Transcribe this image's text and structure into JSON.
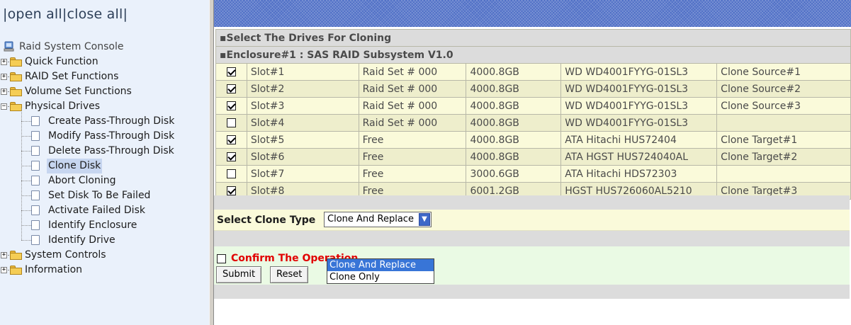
{
  "nav": {
    "open_all": "open all",
    "close_all": "close all",
    "root": {
      "label": "Raid System Console",
      "icon": "computer-icon"
    },
    "items": [
      {
        "label": "Quick Function",
        "icon": "folder-icon",
        "expanded": false
      },
      {
        "label": "RAID Set Functions",
        "icon": "folder-icon",
        "expanded": false
      },
      {
        "label": "Volume Set Functions",
        "icon": "folder-icon",
        "expanded": false
      },
      {
        "label": "Physical Drives",
        "icon": "folder-open-icon",
        "expanded": true,
        "children": [
          {
            "label": "Create Pass-Through Disk",
            "icon": "page-icon"
          },
          {
            "label": "Modify Pass-Through Disk",
            "icon": "page-icon"
          },
          {
            "label": "Delete Pass-Through Disk",
            "icon": "page-icon"
          },
          {
            "label": "Clone Disk",
            "icon": "page-icon",
            "selected": true
          },
          {
            "label": "Abort Cloning",
            "icon": "page-icon"
          },
          {
            "label": "Set Disk To Be Failed",
            "icon": "page-icon"
          },
          {
            "label": "Activate Failed Disk",
            "icon": "page-icon"
          },
          {
            "label": "Identify Enclosure",
            "icon": "page-icon"
          },
          {
            "label": "Identify Drive",
            "icon": "page-icon"
          }
        ]
      },
      {
        "label": "System Controls",
        "icon": "folder-icon",
        "expanded": false
      },
      {
        "label": "Information",
        "icon": "folder-icon",
        "expanded": false
      }
    ]
  },
  "main": {
    "section_title": "Select The Drives For Cloning",
    "enclosure_title": "Enclosure#1 : SAS RAID Subsystem V1.0",
    "drives": [
      {
        "checked": true,
        "slot": "Slot#1",
        "raid": "Raid Set # 000",
        "capacity": "4000.8GB",
        "model": "WD WD4001FYYG-01SL3",
        "role": "Clone Source#1"
      },
      {
        "checked": true,
        "slot": "Slot#2",
        "raid": "Raid Set # 000",
        "capacity": "4000.8GB",
        "model": "WD WD4001FYYG-01SL3",
        "role": "Clone Source#2"
      },
      {
        "checked": true,
        "slot": "Slot#3",
        "raid": "Raid Set # 000",
        "capacity": "4000.8GB",
        "model": "WD WD4001FYYG-01SL3",
        "role": "Clone Source#3"
      },
      {
        "checked": false,
        "slot": "Slot#4",
        "raid": "Raid Set # 000",
        "capacity": "4000.8GB",
        "model": "WD WD4001FYYG-01SL3",
        "role": ""
      },
      {
        "checked": true,
        "slot": "Slot#5",
        "raid": "Free",
        "capacity": "4000.8GB",
        "model": "ATA Hitachi HUS72404",
        "role": "Clone Target#1"
      },
      {
        "checked": true,
        "slot": "Slot#6",
        "raid": "Free",
        "capacity": "4000.8GB",
        "model": "ATA HGST HUS724040AL",
        "role": "Clone Target#2"
      },
      {
        "checked": false,
        "slot": "Slot#7",
        "raid": "Free",
        "capacity": "3000.6GB",
        "model": "ATA Hitachi HDS72303",
        "role": ""
      },
      {
        "checked": true,
        "slot": "Slot#8",
        "raid": "Free",
        "capacity": "6001.2GB",
        "model": "HGST HUS726060AL5210",
        "role": "Clone Target#3"
      }
    ],
    "clone_type": {
      "label": "Select Clone Type",
      "selected": "Clone And Replace",
      "options": [
        "Clone And Replace",
        "Clone Only"
      ],
      "highlighted_index": 0
    },
    "confirm": {
      "label": "Confirm The Operation",
      "checked": false
    },
    "buttons": {
      "submit": "Submit",
      "reset": "Reset"
    }
  },
  "colors": {
    "banner": "#4f6fc6",
    "nav_bg": "#eaf1fb",
    "row_light": "#fafada",
    "row_dark": "#eeeecc",
    "confirm_bg": "#eafae4",
    "confirm_text": "#e10000",
    "dropdown_highlight": "#3875d7"
  }
}
